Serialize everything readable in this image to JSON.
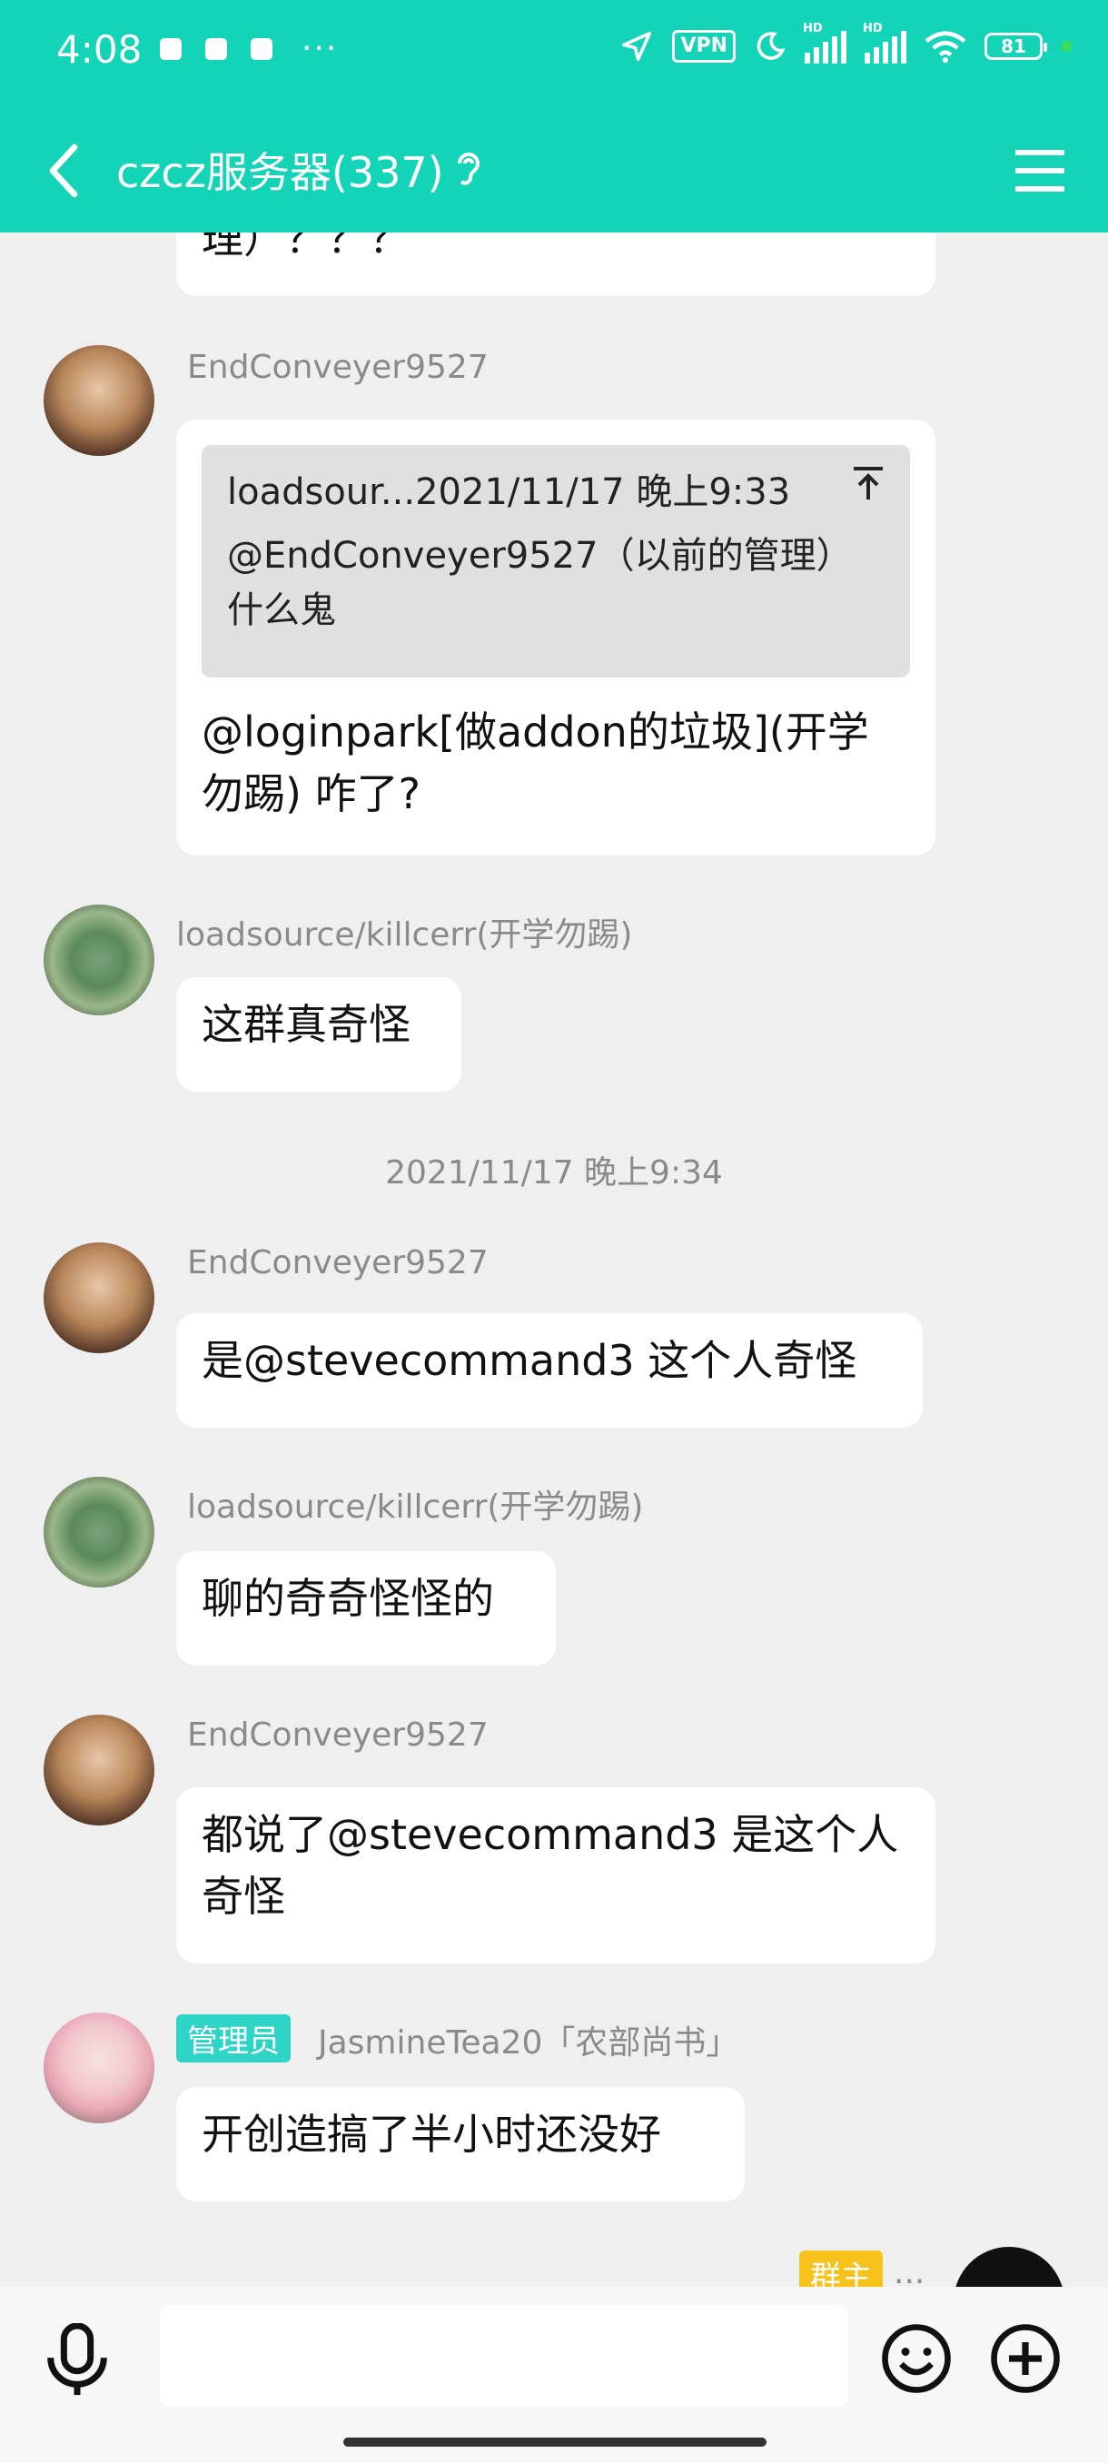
{
  "status_bar": {
    "time": "4:08",
    "more": "···",
    "vpn": "VPN",
    "hd1": "HD",
    "hd2": "HD",
    "battery": "81"
  },
  "header": {
    "title": "czcz服务器(337)"
  },
  "messages": {
    "m0": {
      "text_fragment": "理）？？？"
    },
    "m1": {
      "user": "EndConveyer9527",
      "quote_head": "loadsour...2021/11/17 晚上9:33",
      "quote_body": "@EndConveyer9527（以前的管理）什么鬼",
      "text": "@loginpark[做addon的垃圾](开学勿踢) 咋了?"
    },
    "m2": {
      "user": "loadsource/killcerr(开学勿踢)",
      "text": "这群真奇怪"
    },
    "timestamp": "2021/11/17 晚上9:34",
    "m3": {
      "user": "EndConveyer9527",
      "text": "是@stevecommand3 这个人奇怪"
    },
    "m4": {
      "user": "loadsource/killcerr(开学勿踢)",
      "text": "聊的奇奇怪怪的"
    },
    "m5": {
      "user": "EndConveyer9527",
      "text": "都说了@stevecommand3 是这个人奇怪"
    },
    "m6": {
      "badge": "管理员",
      "user": "JasmineTea20「农部尚书」",
      "text": "开创造搞了半小时还没好"
    },
    "m7": {
      "badge": "群主",
      "user": "..."
    }
  },
  "colors": {
    "accent": "#14d4b8",
    "admin_badge": "#2ed4c5",
    "owner_badge": "#f6c21b",
    "background": "#efefef"
  },
  "icons": [
    "back-arrow-icon",
    "ear-icon",
    "menu-icon",
    "mic-icon",
    "emoji-icon",
    "plus-icon",
    "location-icon",
    "moon-icon",
    "wifi-icon",
    "signal-icon",
    "battery-icon"
  ]
}
